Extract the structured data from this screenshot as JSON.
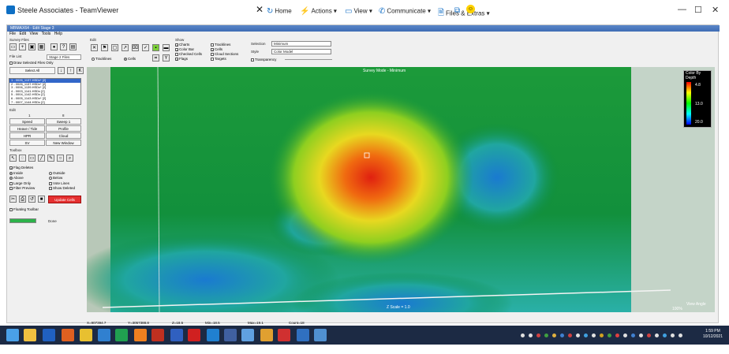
{
  "teamviewer": {
    "title": "Steele Associates - TeamViewer",
    "toolbar": {
      "home": "Home",
      "actions": "Actions",
      "view": "View",
      "communicate": "Communicate",
      "files_extras": "Files & Extras"
    }
  },
  "app": {
    "title": "MBMAX64 - Edit Stage 3",
    "menu": [
      "File",
      "Edit",
      "View",
      "Tools",
      "Help"
    ],
    "survey_files_label": "Survey Files",
    "file_list_label": "File List",
    "stage_select": "Stage 2 Files",
    "draw_selected_label": "Draw Selected Files Only",
    "select_all": "Select All",
    "files": [
      "1 - 0026_1137.HSDx* [2]",
      "2 - 0026_1137.HSDx* [2]",
      "3 - 0006_1139.HSDx* [2]",
      "4 - 0003_1141.HSDx [2]",
      "5 - 0004_1142.HSDx [2]",
      "6 - 0005_1143.HSDx* [2]",
      "7 - 0007_1144.HSDx [2]"
    ],
    "edit_label": "Edit",
    "edit_col1": "1",
    "edit_col2": "8",
    "buttons": {
      "speed": "Speed",
      "sweep": "Sweep 1",
      "heave_tide": "Heave / Tide",
      "profile": "Profile",
      "hpr": "HPR",
      "cloud": "Cloud",
      "sv": "SV",
      "new_window": "New Window",
      "update_cells": "Update Cells"
    },
    "toolbox_label": "Toolbox",
    "flag_deletes": "Flag Deletes",
    "options": {
      "inside": "Inside",
      "outside": "Outside",
      "above": "Above",
      "below": "Below",
      "large_only": "Large Only",
      "vote_lines": "Vote Lines",
      "filter_preview": "Filter Preview",
      "show_deleted": "Show Deleted"
    },
    "floating_toolbar": "Floating Toolbar",
    "progress_label": "Done",
    "edit_section": {
      "label": "Edit",
      "tracklines": "Tracklines",
      "cells": "Cells"
    },
    "show": {
      "label": "Show",
      "charts": "Charts",
      "color_bar": "Color Bar",
      "checked_cells": "Checked Cells",
      "flags": "Flags",
      "tracklines": "Tracklines",
      "cells": "Cells",
      "cloud_sections": "Cloud Sections",
      "targets": "Targets"
    },
    "selection": {
      "label": "Selection",
      "value": "Minimum",
      "style_label": "Style",
      "style_value": "Color Model",
      "transparency": "Transparency"
    },
    "viewport": {
      "overlay_title": "Survey Mode - Minimum",
      "scale_text": "Z Scale = 1.0",
      "view_angle": "View Angle",
      "zoom": "100%"
    },
    "legend": {
      "title": "Color By Depth",
      "ticks": [
        "4.8",
        "13.0",
        "20.0"
      ]
    },
    "status": {
      "x": "X=907394.7",
      "y": "Y=3057388.8",
      "z": "Z=18.5",
      "min": "Min=18.5",
      "max": "Max=19.1",
      "count": "Count=18"
    }
  },
  "taskbar": {
    "time": "1:59 PM",
    "date": "10/12/2021"
  },
  "colors": {
    "taskbar": "#1c2a44",
    "app_title": "#3e6cb4",
    "update_button": "#e53030"
  }
}
